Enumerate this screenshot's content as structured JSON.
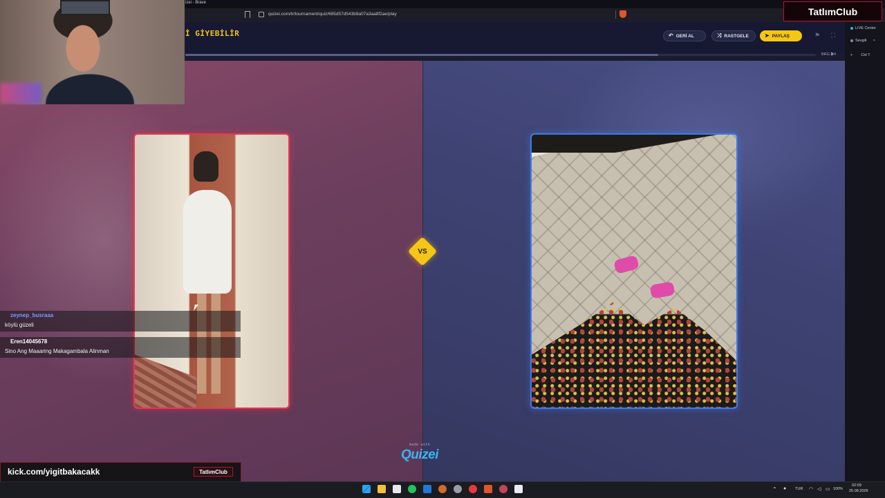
{
  "browser": {
    "tab_title": "izei - Brave",
    "url": "quizei.com/tr/tournament/quiz/695d57d543b9a07a3aa8f2ae/play"
  },
  "header": {
    "quiz_title": "İ GİYEBİLİR",
    "back_label": "GERİ AL",
    "random_label": "RASTGELE",
    "share_label": "PAYLAŞ",
    "round_prefix": "BRG",
    "round_current": "3",
    "round_total": "/4",
    "progress": 0.75
  },
  "battle": {
    "vs_label": "VS",
    "made_with": "made with",
    "logo": "Quizei"
  },
  "sidepanel": {
    "live_center": "LIVE Center",
    "tab_label": "Sevgili",
    "shortcut": "Ctrl  T"
  },
  "stream": {
    "brand": "TatlımClub",
    "kick_url": "kick.com/yigitbakacakk",
    "kick_badge": "TatlımClub",
    "chat": [
      {
        "user": "zeynep_busraaa",
        "text": "köylü güzeli"
      },
      {
        "user": "Eren14045678",
        "text": "Sino Ang Maaaring Makagambala Alinman"
      }
    ]
  },
  "taskbar": {
    "language": "TUR",
    "battery": "100%",
    "time": "02:09",
    "date": "25.08.2026"
  },
  "colors": {
    "accent_yellow": "#f6c615",
    "left_card_border": "#e8364f",
    "right_card_border": "#3d7be6",
    "logo_blue": "#3ab4f5"
  }
}
